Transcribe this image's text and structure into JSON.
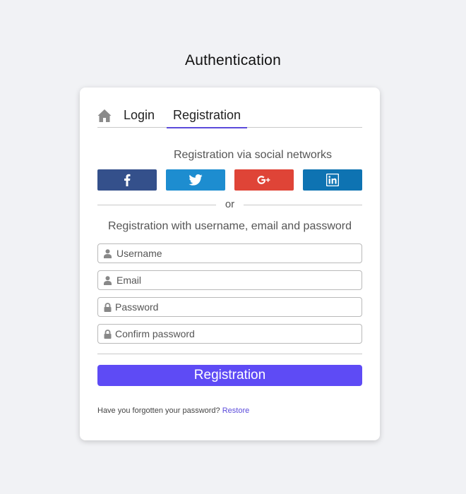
{
  "page": {
    "title": "Authentication"
  },
  "tabs": [
    {
      "label": "Login"
    },
    {
      "label": "Registration",
      "active": true
    }
  ],
  "social": {
    "caption": "Registration via social networks",
    "buttons": [
      {
        "name": "facebook",
        "icon": "facebook-icon",
        "color": "#34508b"
      },
      {
        "name": "twitter",
        "icon": "twitter-icon",
        "color": "#1d8dd0"
      },
      {
        "name": "google-plus",
        "icon": "google-plus-icon",
        "color": "#df4437"
      },
      {
        "name": "linkedin",
        "icon": "linkedin-icon",
        "color": "#0e73b2"
      }
    ]
  },
  "divider": {
    "text": "or"
  },
  "form": {
    "caption": "Registration with username, email and password",
    "fields": [
      {
        "placeholder": "Username",
        "icon": "user-icon"
      },
      {
        "placeholder": "Email",
        "icon": "user-icon"
      },
      {
        "placeholder": "Password",
        "icon": "lock-icon"
      },
      {
        "placeholder": "Confirm password",
        "icon": "lock-icon"
      }
    ],
    "submit_label": "Registration"
  },
  "footer": {
    "forgot_text": "Have you forgotten your password?",
    "restore_link": "Restore"
  },
  "colors": {
    "accent": "#5e4bf5",
    "background": "#f1f2f5"
  }
}
